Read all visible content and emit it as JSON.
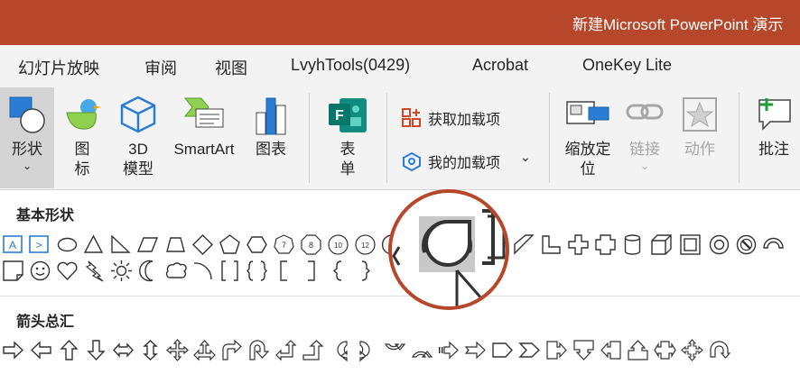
{
  "window": {
    "title": "新建Microsoft PowerPoint 演示"
  },
  "tabs": [
    "幻灯片放映",
    "审阅",
    "视图",
    "LvyhTools(0429)",
    "Acrobat",
    "OneKey Lite"
  ],
  "ribbon": {
    "shapes_label": "形状",
    "icons_label": "图\n标",
    "model3d_label": "3D\n模型",
    "smartart_label": "SmartArt",
    "chart_label": "图表",
    "forms_label": "表\n单",
    "get_addins_label": "获取加载项",
    "my_addins_label": "我的加载项",
    "zoom_label": "缩放定\n位",
    "link_label": "链接",
    "action_label": "动作",
    "comment_label": "批注"
  },
  "gallery": {
    "basic_shapes_header": "基本形状",
    "arrows_header": "箭头总汇",
    "octagon_numbers": [
      "7",
      "8",
      "10",
      "12"
    ]
  },
  "colors": {
    "titlebar": "#b7472a",
    "accent_blue": "#0078d4",
    "forms_green": "#077568",
    "addin_red": "#d24726"
  }
}
